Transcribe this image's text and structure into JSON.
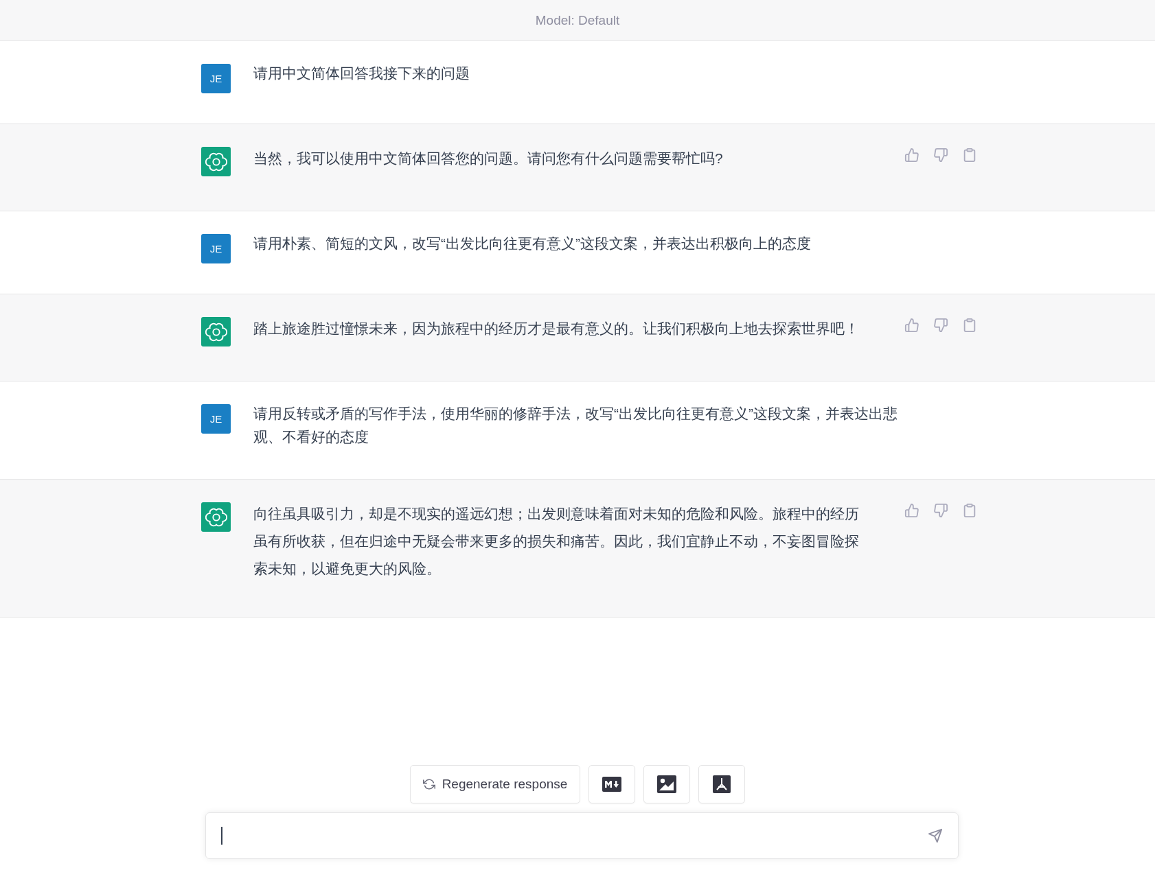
{
  "header": {
    "title": "Model: Default"
  },
  "messages": [
    {
      "kind": "user",
      "avatar": "JE",
      "text": "请用中文简体回答我接下来的问题"
    },
    {
      "kind": "assistant",
      "text": "当然，我可以使用中文简体回答您的问题。请问您有什么问题需要帮忙吗?"
    },
    {
      "kind": "user",
      "avatar": "JE",
      "text": "请用朴素、简短的文风，改写“出发比向往更有意义”这段文案，并表达出积极向上的态度"
    },
    {
      "kind": "assistant",
      "text": "踏上旅途胜过憧憬未来，因为旅程中的经历才是最有意义的。让我们积极向上地去探索世界吧！"
    },
    {
      "kind": "user",
      "avatar": "JE",
      "text": "请用反转或矛盾的写作手法，使用华丽的修辞手法，改写“出发比向往更有意义”这段文案，并表达出悲观、不看好的态度"
    },
    {
      "kind": "assistant",
      "text": "向往虽具吸引力，却是不现实的遥远幻想；出发则意味着面对未知的危险和风险。旅程中的经历虽有所收获，但在归途中无疑会带来更多的损失和痛苦。因此，我们宜静止不动，不妄图冒险探索未知，以避免更大的风险。"
    }
  ],
  "actions": [
    {
      "kind": "regenerate",
      "label": "Regenerate response"
    },
    {
      "kind": "markdown"
    },
    {
      "kind": "image"
    },
    {
      "kind": "pdf"
    }
  ]
}
